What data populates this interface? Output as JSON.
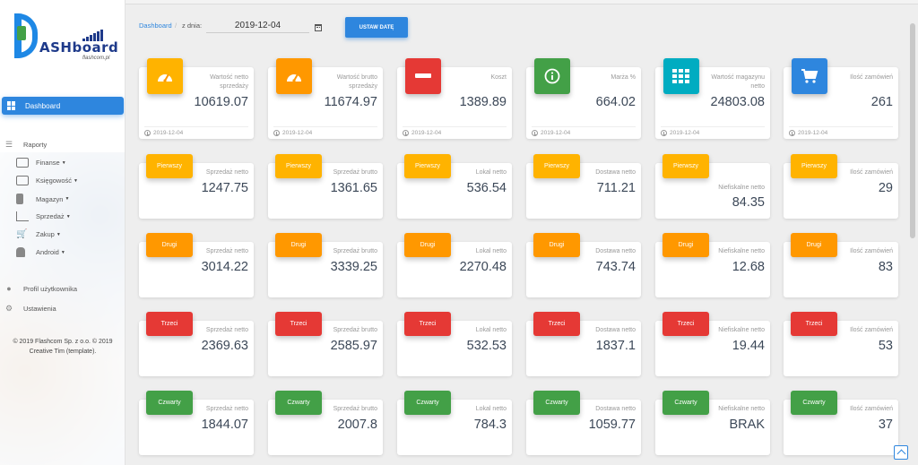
{
  "colors": {
    "orange": "#ff9800",
    "amber": "#ffb300",
    "red": "#e53935",
    "green": "#43a047",
    "cyan": "#00acc1",
    "blue": "#2e86de"
  },
  "logo": {
    "text": "ASHboard",
    "sub": "flashcom.pl"
  },
  "sidebar": {
    "active": "Dashboard",
    "raporty": "Raporty",
    "subitems": [
      "Finanse",
      "Księgowość",
      "Magazyn",
      "Sprzedaż",
      "Zakup",
      "Android"
    ],
    "profile": "Profil użytkownika",
    "settings": "Ustawienia",
    "footer": "© 2019 Flashcom Sp. z o.o. © 2019 Creative Tim (template)."
  },
  "header": {
    "breadcrumb": "Dashboard",
    "separator": "/",
    "date_label": "z dnia:",
    "date_value": "2019-12-04",
    "button": "USTAW DATĘ"
  },
  "summary": [
    {
      "icon": "speedometer-icon",
      "color": "amber",
      "label": "Wartość netto sprzedaży",
      "value": "10619.07",
      "date": "2019-12-04"
    },
    {
      "icon": "speedometer-icon",
      "color": "orange",
      "label": "Wartość brutto sprzedaży",
      "value": "11674.97",
      "date": "2019-12-04"
    },
    {
      "icon": "minus-icon",
      "color": "red",
      "label": "Koszt",
      "value": "1389.89",
      "date": "2019-12-04"
    },
    {
      "icon": "info-icon",
      "color": "green",
      "label": "Marża %",
      "value": "664.02",
      "date": "2019-12-04"
    },
    {
      "icon": "grid-icon",
      "color": "cyan",
      "label": "Wartość magazynu netto",
      "value": "24803.08",
      "date": "2019-12-04"
    },
    {
      "icon": "cart-icon",
      "color": "blue",
      "label": "Ilość zamówień",
      "value": "261",
      "date": "2019-12-04"
    }
  ],
  "rows": [
    {
      "tag": "Pierwszy",
      "color": "amber",
      "cards": [
        {
          "label": "Sprzedaż netto",
          "value": "1247.75"
        },
        {
          "label": "Sprzedaż brutto",
          "value": "1361.65"
        },
        {
          "label": "Lokal netto",
          "value": "536.54"
        },
        {
          "label": "Dostawa netto",
          "value": "711.21"
        },
        {
          "label": "Niefiskalne netto",
          "value": "84.35"
        },
        {
          "label": "Ilość zamówień",
          "value": "29"
        }
      ]
    },
    {
      "tag": "Drugi",
      "color": "orange",
      "cards": [
        {
          "label": "Sprzedaż netto",
          "value": "3014.22"
        },
        {
          "label": "Sprzedaż brutto",
          "value": "3339.25"
        },
        {
          "label": "Lokal netto",
          "value": "2270.48"
        },
        {
          "label": "Dostawa netto",
          "value": "743.74"
        },
        {
          "label": "Niefiskalne netto",
          "value": "12.68"
        },
        {
          "label": "Ilość zamówień",
          "value": "83"
        }
      ]
    },
    {
      "tag": "Trzeci",
      "color": "red",
      "cards": [
        {
          "label": "Sprzedaż netto",
          "value": "2369.63"
        },
        {
          "label": "Sprzedaż brutto",
          "value": "2585.97"
        },
        {
          "label": "Lokal netto",
          "value": "532.53"
        },
        {
          "label": "Dostawa netto",
          "value": "1837.1"
        },
        {
          "label": "Niefiskalne netto",
          "value": "19.44"
        },
        {
          "label": "Ilość zamówień",
          "value": "53"
        }
      ]
    },
    {
      "tag": "Czwarty",
      "color": "green",
      "cards": [
        {
          "label": "Sprzedaż netto",
          "value": "1844.07"
        },
        {
          "label": "Sprzedaż brutto",
          "value": "2007.8"
        },
        {
          "label": "Lokal netto",
          "value": "784.3"
        },
        {
          "label": "Dostawa netto",
          "value": "1059.77"
        },
        {
          "label": "Niefiskalne netto",
          "value": "BRAK"
        },
        {
          "label": "Ilość zamówień",
          "value": "37"
        }
      ]
    }
  ]
}
